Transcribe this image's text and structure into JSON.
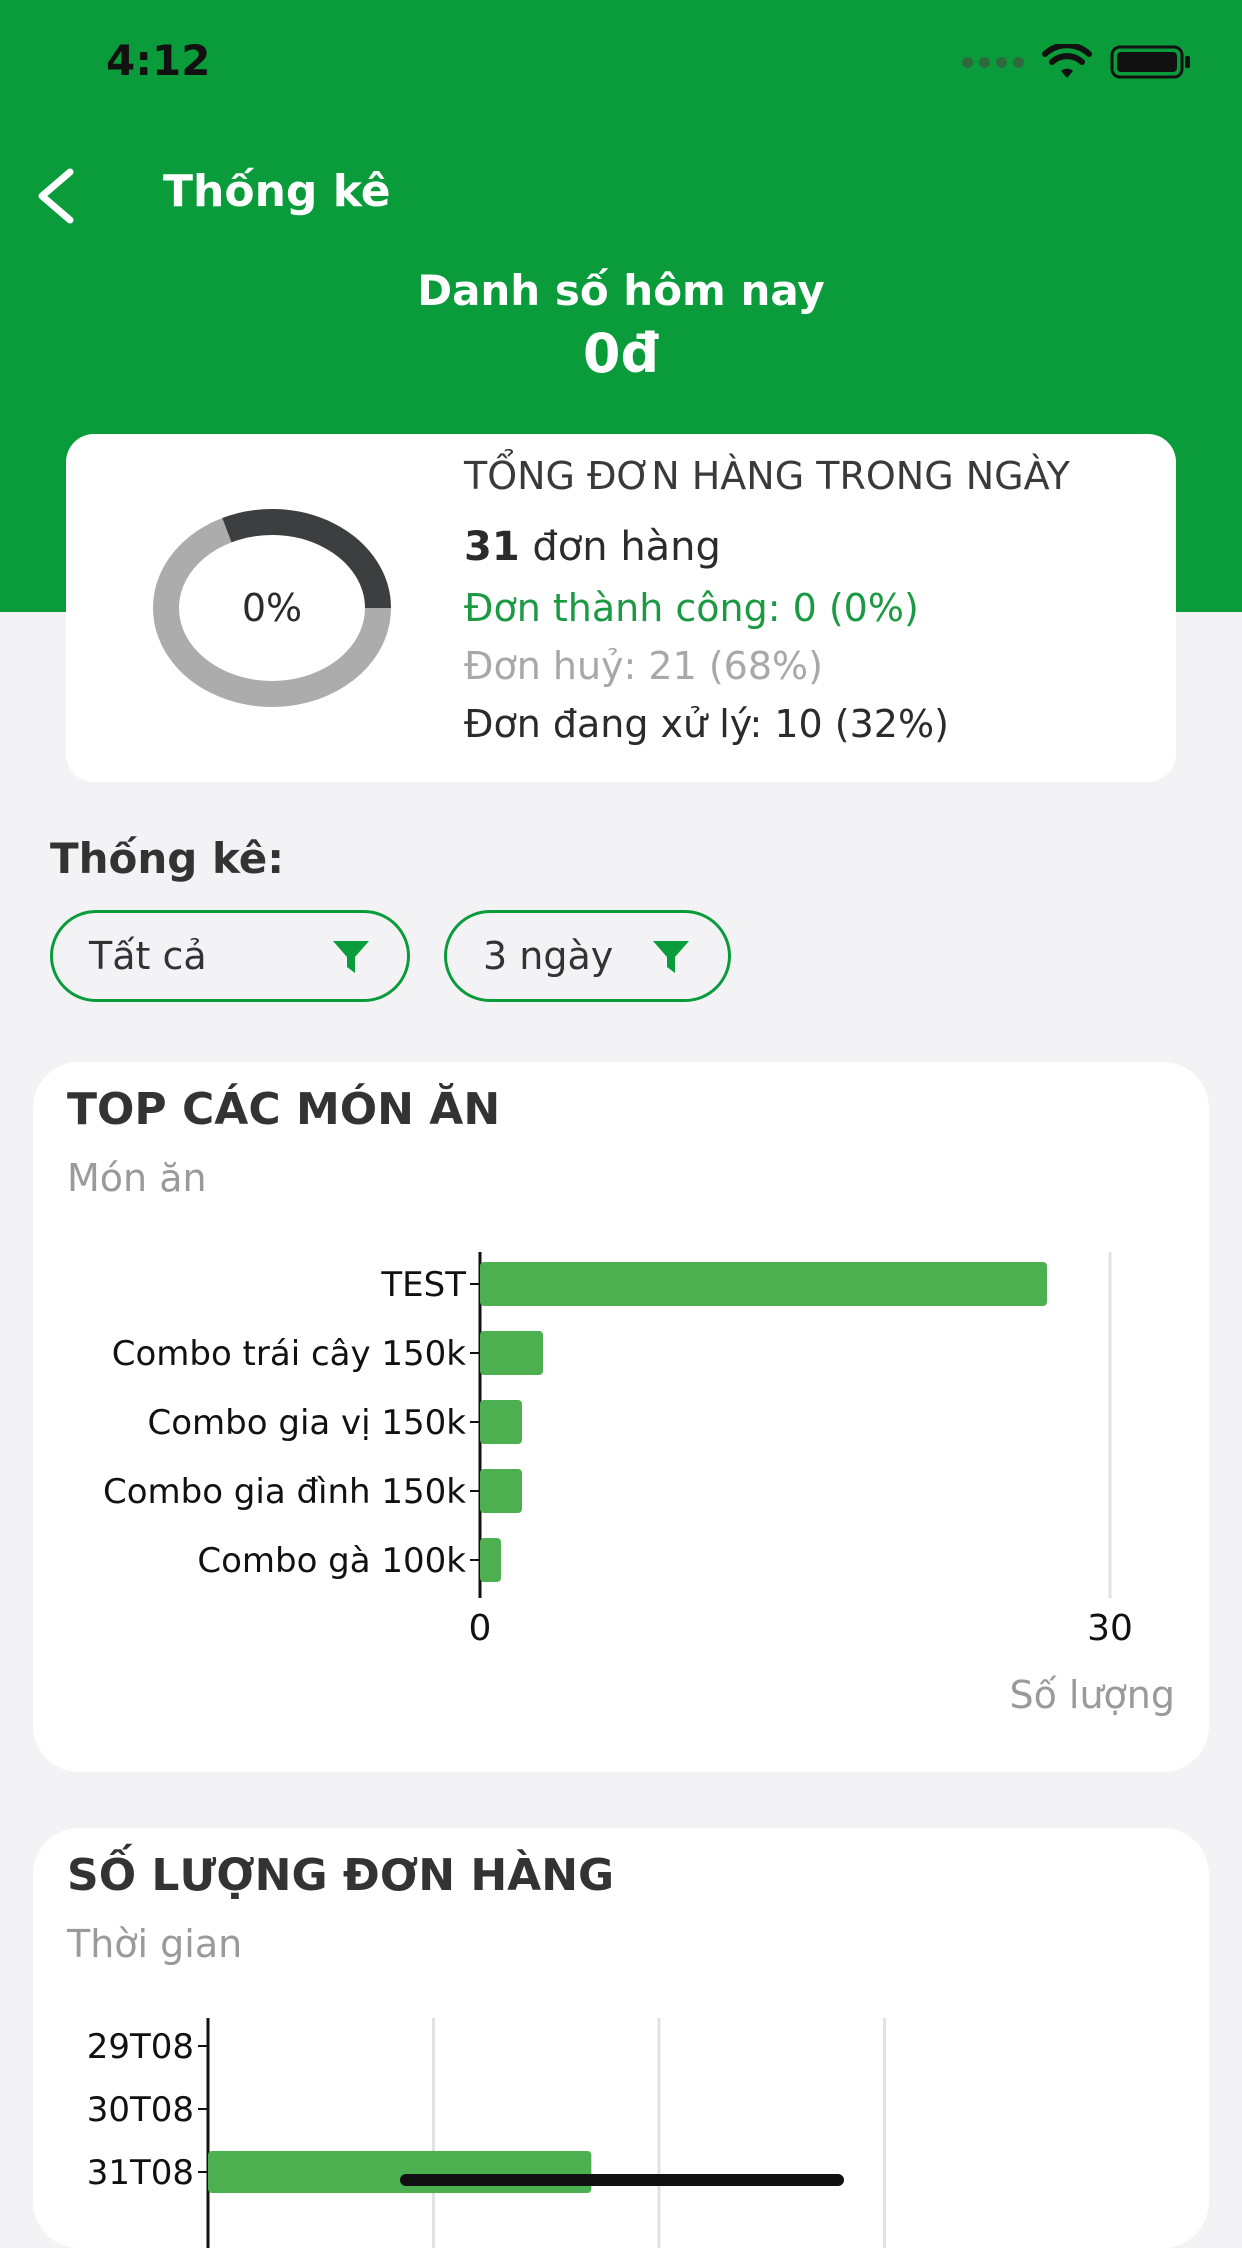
{
  "status_bar": {
    "time": "4:12"
  },
  "nav": {
    "title": "Thống kê",
    "back_icon": "chevron-left-icon"
  },
  "today": {
    "label": "Danh số hôm nay",
    "value": "0đ"
  },
  "summary": {
    "donut_percent": "0%",
    "title": "TỔNG ĐƠN HÀNG TRONG NGÀY",
    "total_count": "31",
    "total_suffix": "đơn hàng",
    "success": "Đơn thành công: 0 (0%)",
    "cancelled": "Đơn huỷ: 21 (68%)",
    "processing": "Đơn đang xử lý: 10 (32%)",
    "donut_segments": [
      {
        "name": "processing",
        "fraction": 0.32,
        "color": "#3d3e40"
      },
      {
        "name": "cancelled",
        "fraction": 0.68,
        "color": "#acacac"
      }
    ]
  },
  "filters": {
    "label": "Thống kê:",
    "category": "Tất cả",
    "period": "3 ngày",
    "accent": "#0a9b3a"
  },
  "top_dishes": {
    "title": "TOP CÁC MÓN ĂN",
    "subtitle": "Món ăn",
    "chart_data": {
      "type": "bar",
      "orientation": "horizontal",
      "categories": [
        "TEST",
        "Combo trái cây 150k",
        "Combo gia vị 150k",
        "Combo gia đình 150k",
        "Combo gà 100k"
      ],
      "values": [
        27,
        3,
        2,
        2,
        1
      ],
      "xlim": [
        0,
        30
      ],
      "xticks": [
        "0",
        "30"
      ],
      "xlabel": "Số lượng",
      "bar_color": "#4caf50"
    }
  },
  "order_count": {
    "title": "SỐ LƯỢNG ĐƠN HÀNG",
    "subtitle": "Thời gian",
    "chart_data": {
      "type": "bar",
      "orientation": "horizontal",
      "categories": [
        "29T08",
        "30T08",
        "31T08"
      ],
      "values": [
        0,
        0,
        17
      ],
      "xlim": [
        0,
        40
      ],
      "bar_color": "#4caf50"
    }
  }
}
